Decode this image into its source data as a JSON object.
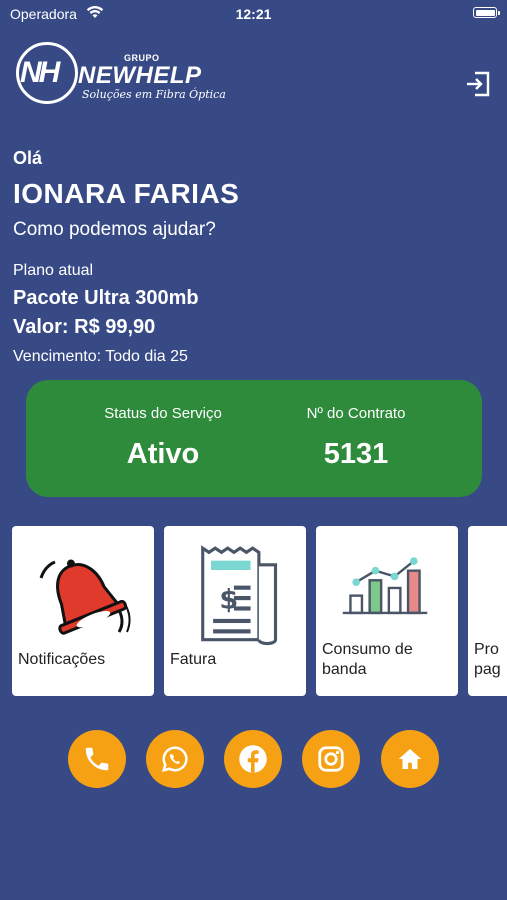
{
  "statusbar": {
    "carrier": "Operadora",
    "time": "12:21"
  },
  "brand": {
    "monogram": "NH",
    "group": "GRUPO",
    "name": "NEWHELP",
    "tagline": "Soluções em Fibra Óptica"
  },
  "greeting": {
    "hello": "Olá",
    "name": "IONARA FARIAS",
    "subtitle": "Como podemos ajudar?"
  },
  "plan": {
    "label": "Plano atual",
    "name": "Pacote Ultra 300mb",
    "value": "Valor: R$ 99,90",
    "due": "Vencimento: Todo dia 25"
  },
  "status_card": {
    "service_label": "Status do Serviço",
    "service_value": "Ativo",
    "contract_label": "Nº do Contrato",
    "contract_value": "5131",
    "color": "#2e8b3b"
  },
  "menu": [
    {
      "label": "Notificações",
      "icon": "bell-icon"
    },
    {
      "label": "Fatura",
      "icon": "invoice-icon"
    },
    {
      "label": "Consumo de banda",
      "icon": "bar-chart-icon"
    },
    {
      "label": "Pro pag",
      "icon": ""
    }
  ],
  "social": [
    {
      "icon": "phone-icon"
    },
    {
      "icon": "whatsapp-icon"
    },
    {
      "icon": "facebook-icon"
    },
    {
      "icon": "instagram-icon"
    },
    {
      "icon": "home-icon"
    }
  ],
  "colors": {
    "background": "#384a86",
    "accent": "#f6a114",
    "card": "#ffffff"
  }
}
